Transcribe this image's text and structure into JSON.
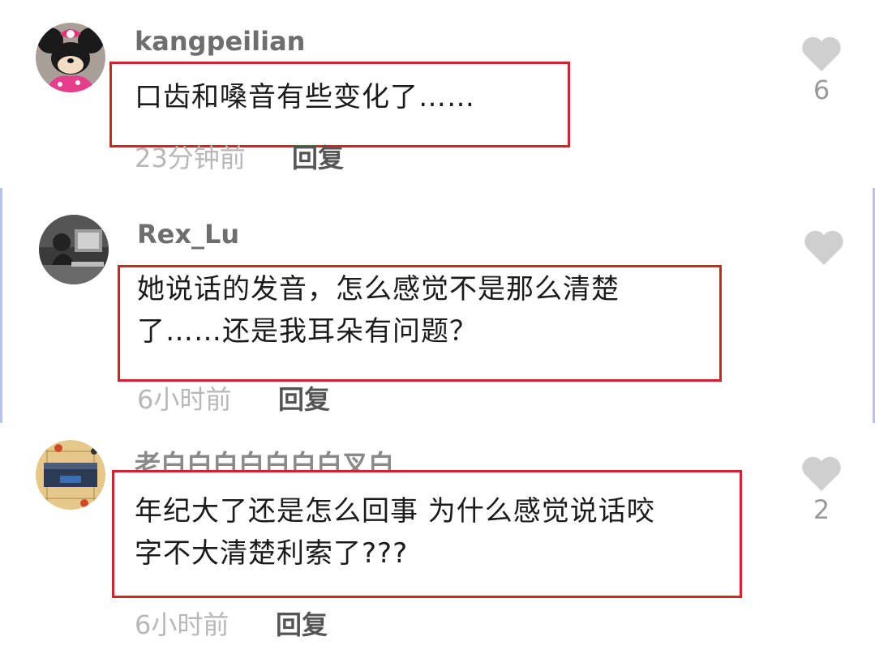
{
  "comments": [
    {
      "username": "kangpeilian",
      "text": "口齿和嗓音有些变化了……",
      "time": "23分钟前",
      "reply_label": "回复",
      "likes": "6",
      "avatar_icon": "minnie-mouse-plush-avatar"
    },
    {
      "username": "Rex_Lu",
      "text": "她说话的发音，怎么感觉不是那么清楚\n了……还是我耳朵有问题？",
      "time": "6小时前",
      "reply_label": "回复",
      "likes": "",
      "avatar_icon": "photo-avatar"
    },
    {
      "username": "老白白白白白白白叉白",
      "text": "年纪大了还是怎么回事 为什么感觉说话咬\n字不大清楚利索了???",
      "time": "6小时前",
      "reply_label": "回复",
      "likes": "2",
      "avatar_icon": "game-screenshot-avatar"
    }
  ],
  "colors": {
    "highlight_box": "#d6202a",
    "heart": "#cfcfcf",
    "meta_text": "#b8b8b8",
    "divider_blue": "#b9c3ea"
  }
}
